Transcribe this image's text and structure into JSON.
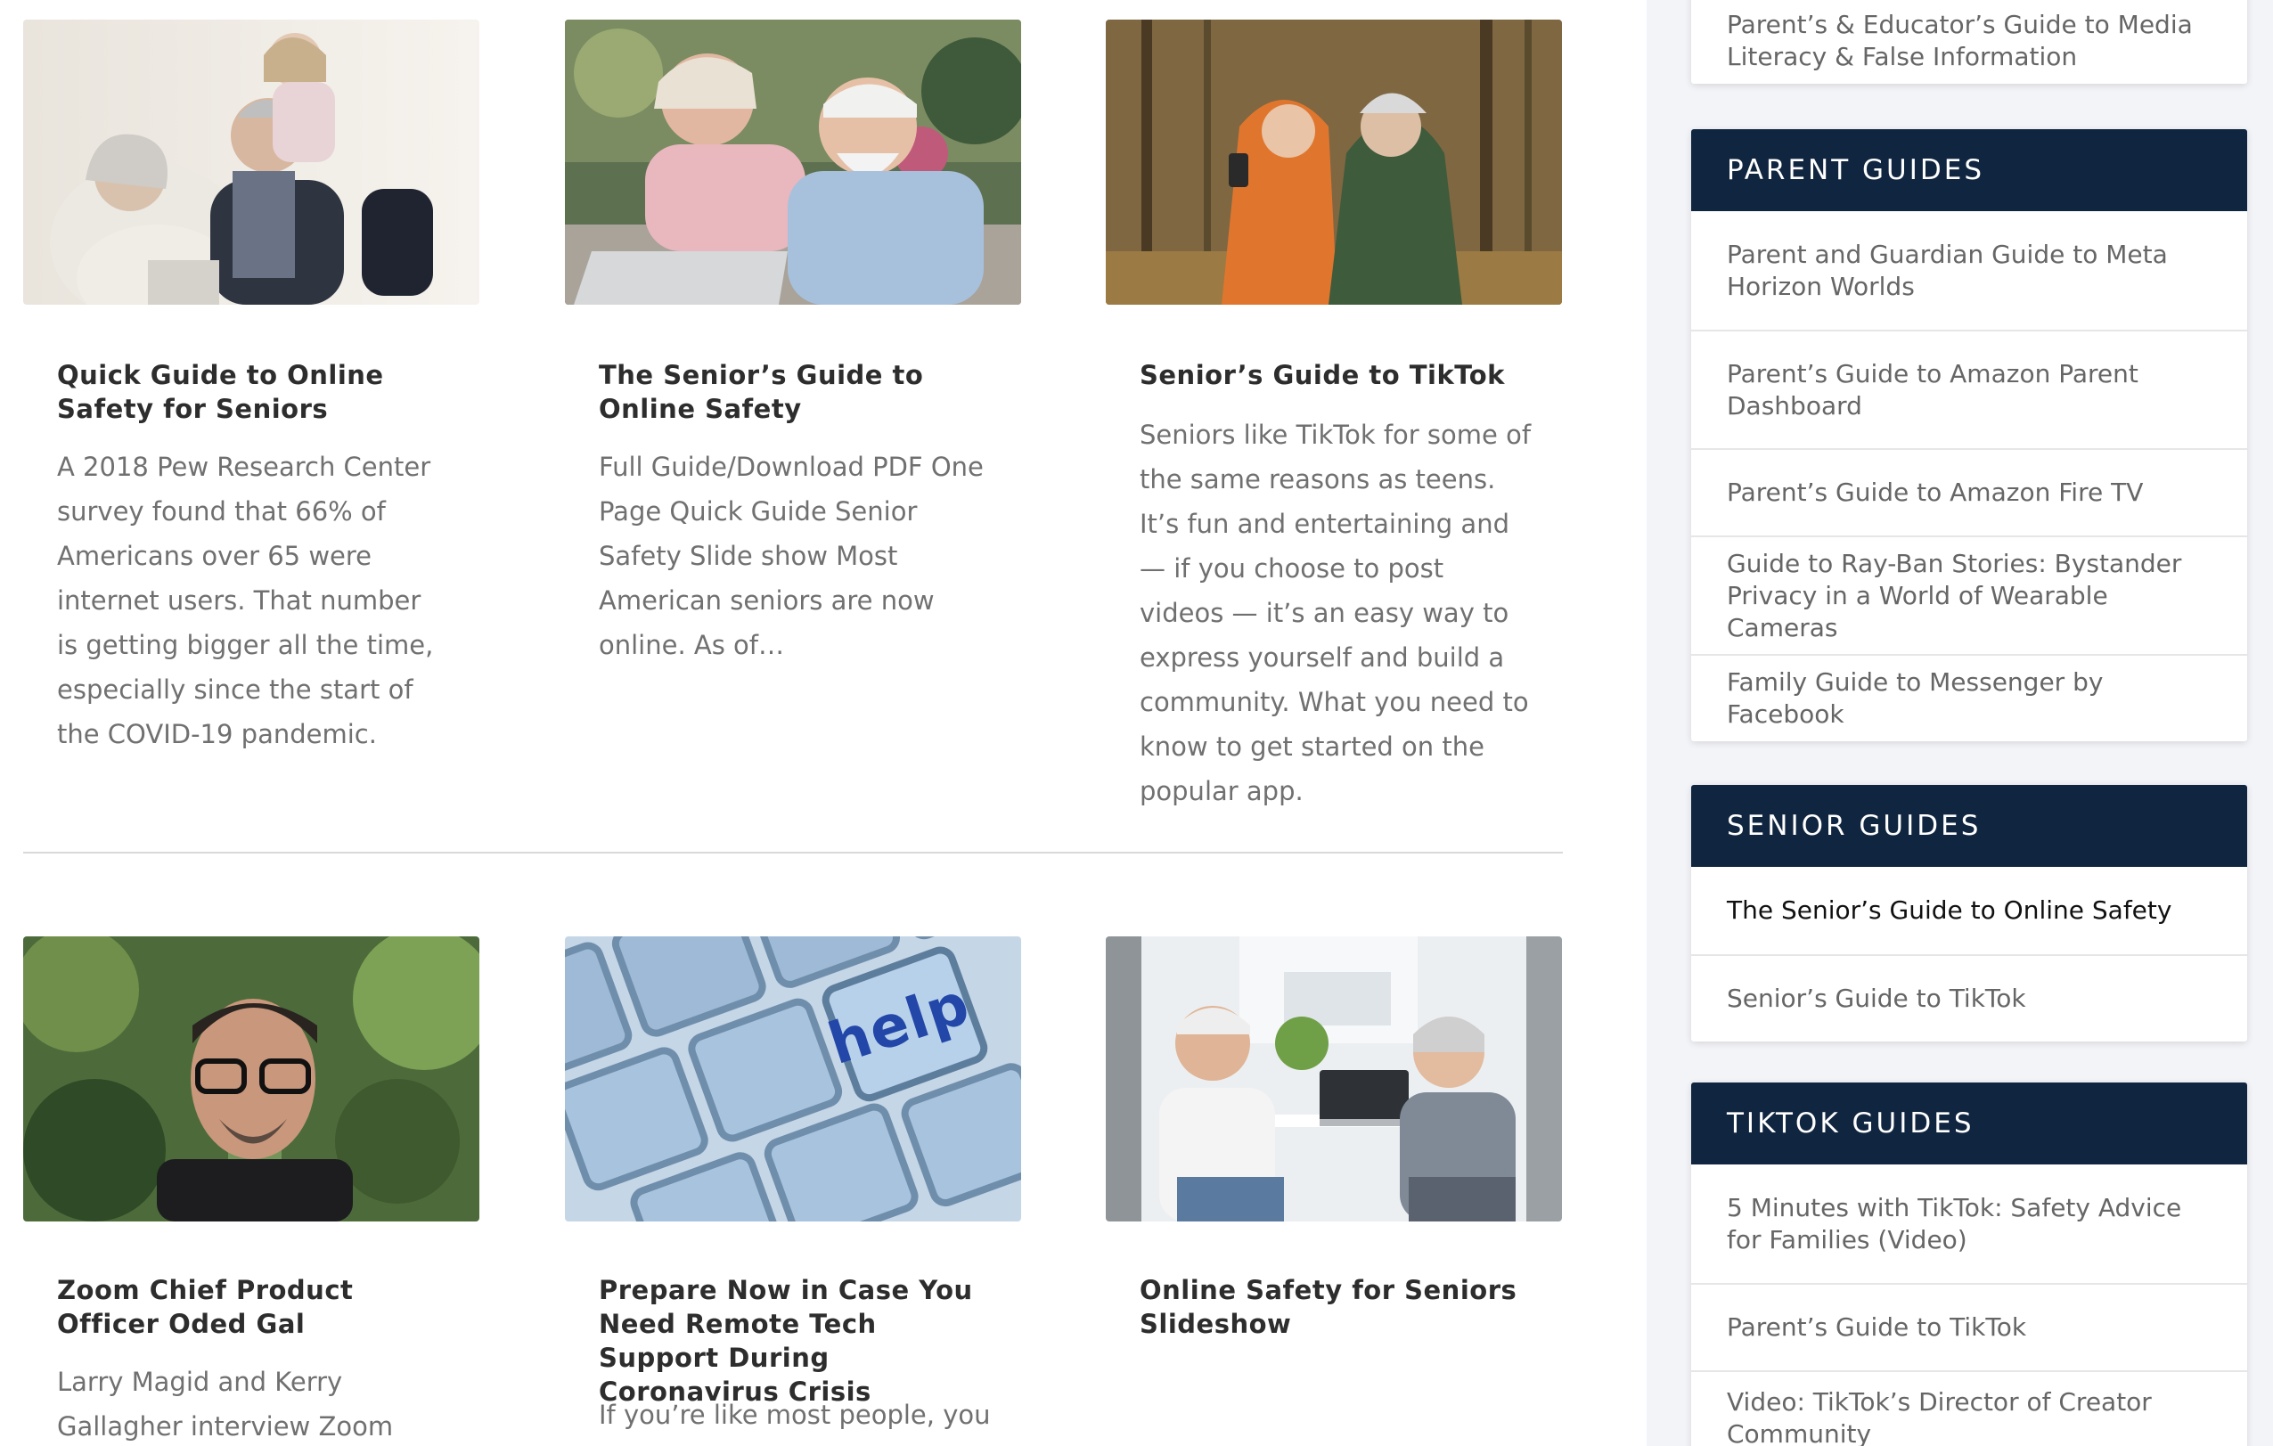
{
  "cards": [
    {
      "title": "Quick Guide to Online Safety for Seniors",
      "excerpt": "A 2018 Pew Research Center survey found that 66% of Americans over 65 were internet users. That number is getting bigger all the time, especially since the start of the COVID-19 pandemic."
    },
    {
      "title": "The Senior’s Guide to Online Safety",
      "excerpt": "Full Guide/Download PDF One Page Quick Guide Senior Safety Slide show Most American seniors are now online. As of…"
    },
    {
      "title": "Senior’s Guide to TikTok",
      "excerpt": "Seniors like TikTok for some of the same reasons as teens. It’s fun and entertaining and — if you choose to post videos — it’s an easy way to express yourself and build a community. What you need to know to get started on the popular app."
    },
    {
      "title": "Zoom Chief Product Officer Oded Gal",
      "excerpt": "Larry Magid and Kerry Gallagher interview Zoom Chief"
    },
    {
      "title": "Prepare Now in Case You Need Remote Tech Support During Coronavirus Crisis",
      "excerpt": "If you’re like most people, you"
    },
    {
      "title": "Online Safety for Seniors Slideshow",
      "excerpt": ""
    }
  ],
  "help_key_label": "help",
  "sidebar": {
    "top_item": "Parent’s & Educator’s Guide to Media Literacy & False Information",
    "parent_guides": {
      "heading": "PARENT GUIDES",
      "items": [
        "Parent and Guardian Guide to Meta Horizon Worlds",
        "Parent’s Guide to Amazon Parent Dashboard",
        "Parent’s Guide to Amazon Fire TV",
        "Guide to Ray-Ban Stories: Bystander Privacy in a World of Wearable Cameras",
        "Family Guide to Messenger by Facebook"
      ]
    },
    "senior_guides": {
      "heading": "SENIOR GUIDES",
      "items": [
        "The Senior’s Guide to Online Safety",
        "Senior’s Guide to TikTok"
      ]
    },
    "tiktok_guides": {
      "heading": "TIKTOK GUIDES",
      "items": [
        "5 Minutes with TikTok: Safety Advice for Families (Video)",
        "Parent’s Guide to TikTok",
        "Video: TikTok’s Director of Creator Community"
      ]
    }
  },
  "colors": {
    "widget_header": "#10253f",
    "sidebar_bg": "#f3f4f8",
    "title_text": "#2d2d2d",
    "body_text": "#707070"
  }
}
